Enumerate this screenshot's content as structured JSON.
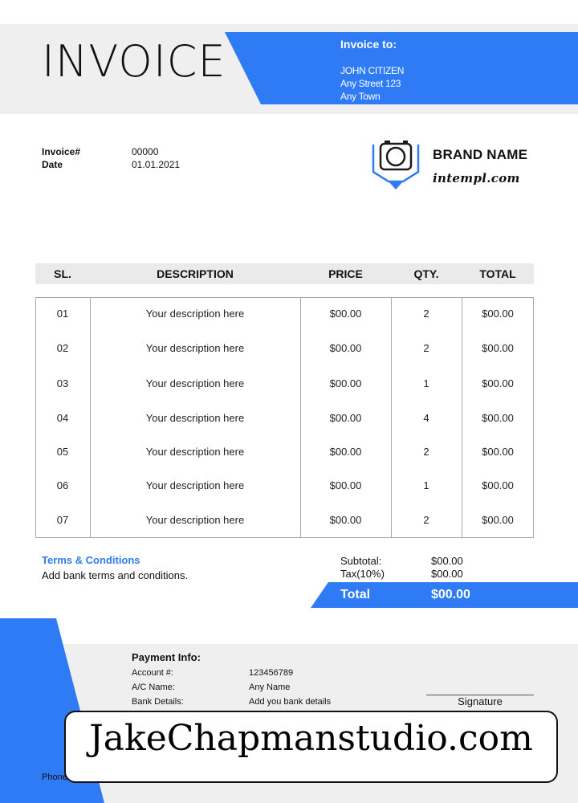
{
  "header": {
    "title": "INVOICE",
    "invoice_to_heading": "Invoice to:",
    "client_lines": [
      "JOHN CITIZEN",
      "Any Street 123",
      "Any Town"
    ]
  },
  "meta": {
    "invoice_label": "Invoice#",
    "invoice_value": "00000",
    "date_label": "Date",
    "date_value": "01.01.2021"
  },
  "brand": {
    "name": "BRAND NAME",
    "url": "intempl.com",
    "logo_icon": "camera-pin-icon"
  },
  "table": {
    "headers": [
      "SL.",
      "DESCRIPTION",
      "PRICE",
      "QTY.",
      "TOTAL"
    ],
    "rows": [
      {
        "sl": "01",
        "description": "Your description here",
        "price": "$00.00",
        "qty": "2",
        "total": "$00.00"
      },
      {
        "sl": "02",
        "description": "Your description here",
        "price": "$00.00",
        "qty": "2",
        "total": "$00.00"
      },
      {
        "sl": "03",
        "description": "Your description here",
        "price": "$00.00",
        "qty": "1",
        "total": "$00.00"
      },
      {
        "sl": "04",
        "description": "Your description here",
        "price": "$00.00",
        "qty": "4",
        "total": "$00.00"
      },
      {
        "sl": "05",
        "description": "Your description here",
        "price": "$00.00",
        "qty": "2",
        "total": "$00.00"
      },
      {
        "sl": "06",
        "description": "Your description here",
        "price": "$00.00",
        "qty": "1",
        "total": "$00.00"
      },
      {
        "sl": "07",
        "description": "Your description here",
        "price": "$00.00",
        "qty": "2",
        "total": "$00.00"
      }
    ]
  },
  "terms": {
    "title": "Terms & Conditions",
    "text": "Add bank terms and conditions."
  },
  "totals": {
    "subtotal_label": "Subtotal:",
    "subtotal_value": "$00.00",
    "tax_label": "Tax(10%)",
    "tax_value": "$00.00",
    "total_label": "Total",
    "total_value": "$00.00"
  },
  "payment": {
    "title": "Payment Info:",
    "account_label": "Account #:",
    "account_value": "123456789",
    "ac_name_label": "A/C Name:",
    "ac_name_value": "Any Name",
    "bank_label": "Bank Details:",
    "bank_value": "Add you bank details",
    "signature_label": "Signature",
    "phone_label": "Phone"
  },
  "watermark": {
    "text": "JakeChapmanstudio.com"
  },
  "colors": {
    "accent": "#2f7bf5",
    "band": "#efefef"
  }
}
